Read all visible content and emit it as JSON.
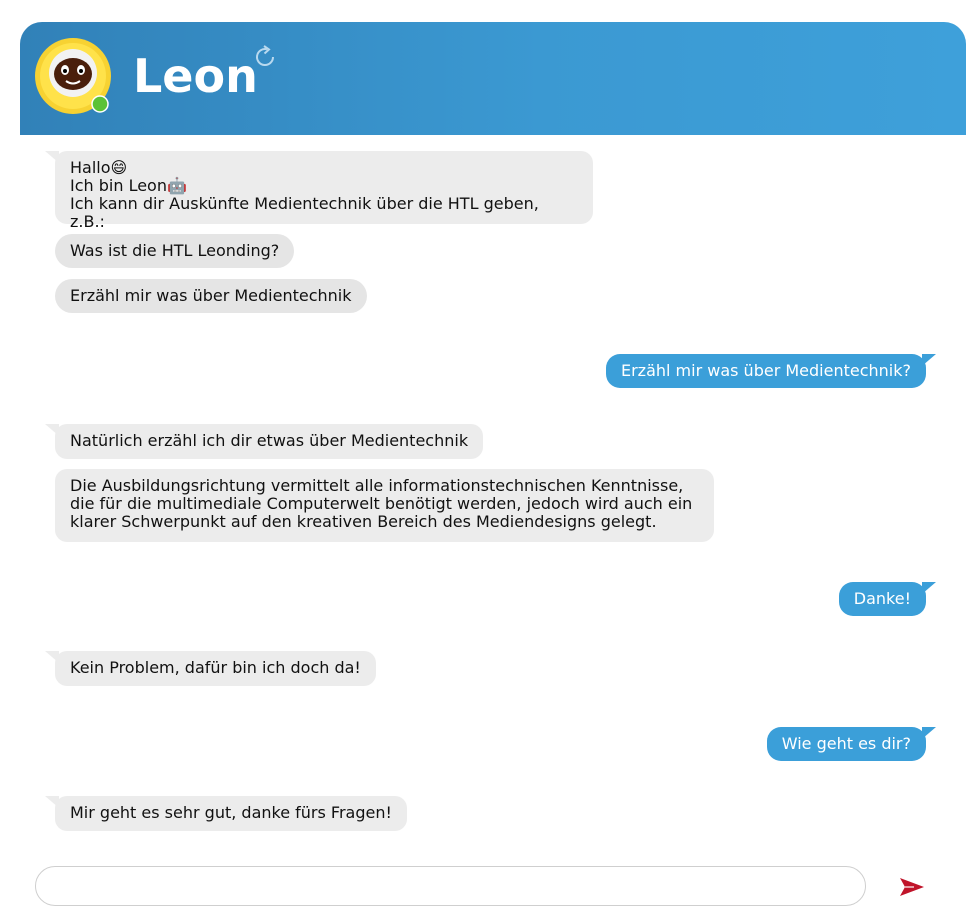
{
  "header": {
    "title": "Leon",
    "avatar_icon": "robot-face-icon",
    "refresh_icon": "refresh-icon",
    "status_color": "#5bc236",
    "gradient": [
      "#3181b8",
      "#3ea0da"
    ]
  },
  "messages": {
    "m1": "Hallo😄\nIch bin Leon🤖\nIch kann dir Auskünfte Medientechnik über die HTL geben, z.B.:",
    "s1": "Was ist die HTL Leonding?",
    "s2": "Erzähl mir was über Medientechnik",
    "u1": "Erzähl mir was über Medientechnik?",
    "m2": "Natürlich erzähl ich dir etwas über Medientechnik",
    "m3": "Die Ausbildungsrichtung vermittelt alle informationstechnischen Kenntnisse,\ndie für die multimediale Computerwelt benötigt werden, jedoch wird auch ein\nklarer Schwerpunkt auf den kreativen Bereich des Mediendesigns gelegt.",
    "u2": "Danke!",
    "m4": "Kein Problem, dafür bin ich doch da!",
    "u3": "Wie geht es dir?",
    "m5": "Mir geht es sehr gut, danke fürs Fragen!"
  },
  "composer": {
    "value": "",
    "placeholder": "",
    "send_icon": "send-icon",
    "send_color": "#c0142a"
  }
}
